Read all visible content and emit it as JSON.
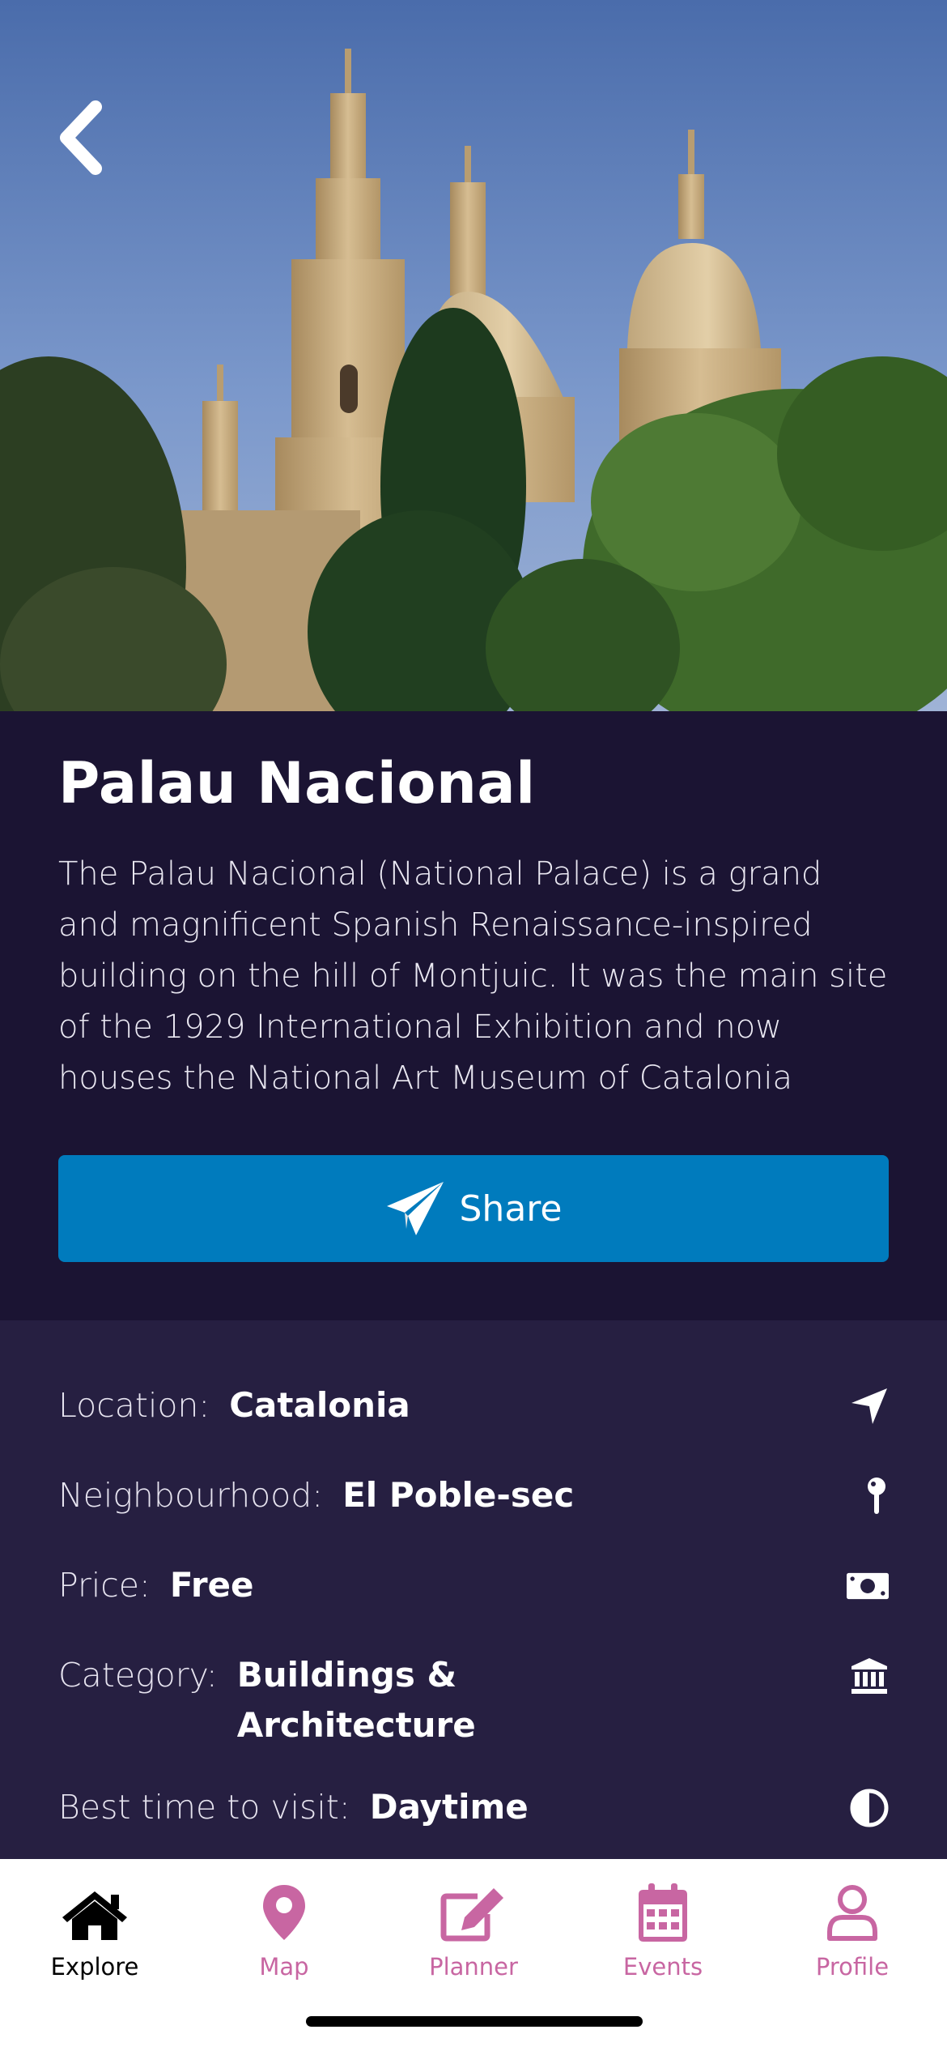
{
  "place": {
    "title": "Palau Nacional",
    "description": "The Palau Nacional (National Palace) is a grand and magnificent Spanish Renaissance-inspired building on the hill of Montjuic. It was the main site of the 1929 International Exhibition and now houses the National Art Museum of Catalonia"
  },
  "share": {
    "label": "Share",
    "icon": "paper-plane-icon"
  },
  "details": [
    {
      "label": "Location:",
      "value": "Catalonia",
      "icon": "location-arrow-icon"
    },
    {
      "label": "Neighbourhood:",
      "value": "El Poble-sec",
      "icon": "pin-icon"
    },
    {
      "label": "Price:",
      "value": "Free",
      "icon": "money-icon"
    },
    {
      "label": "Category:",
      "value": "Buildings & Architecture",
      "icon": "landmark-icon"
    },
    {
      "label": "Best time to visit:",
      "value": "Daytime",
      "icon": "half-circle-icon"
    }
  ],
  "tabs": [
    {
      "label": "Explore",
      "icon": "home-icon",
      "active": true
    },
    {
      "label": "Map",
      "icon": "map-marker-icon",
      "active": false
    },
    {
      "label": "Planner",
      "icon": "edit-icon",
      "active": false
    },
    {
      "label": "Events",
      "icon": "calendar-icon",
      "active": false
    },
    {
      "label": "Profile",
      "icon": "user-icon",
      "active": false
    }
  ],
  "colors": {
    "background": "#1b1433",
    "details_background": "#261f41",
    "share_button": "#007bbd",
    "tab_active": "#000000",
    "tab_inactive": "#c866a2"
  }
}
